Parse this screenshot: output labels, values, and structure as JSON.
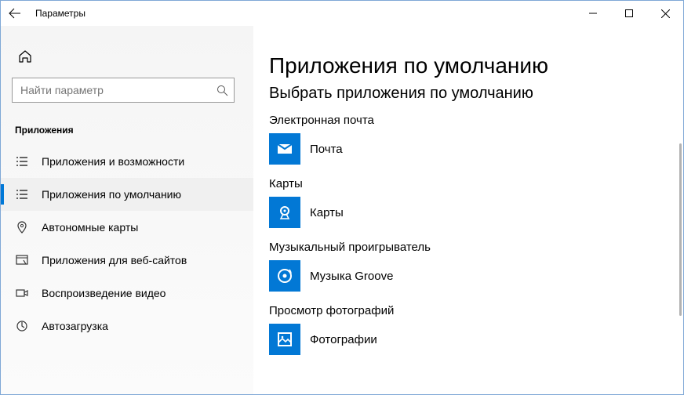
{
  "window": {
    "title": "Параметры"
  },
  "search": {
    "placeholder": "Найти параметр"
  },
  "category": {
    "label": "Приложения"
  },
  "nav": {
    "items": [
      {
        "label": "Приложения и возможности"
      },
      {
        "label": "Приложения по умолчанию"
      },
      {
        "label": "Автономные карты"
      },
      {
        "label": "Приложения для веб-сайтов"
      },
      {
        "label": "Воспроизведение видео"
      },
      {
        "label": "Автозагрузка"
      }
    ]
  },
  "main": {
    "title": "Приложения по умолчанию",
    "subtitle": "Выбрать приложения по умолчанию",
    "sections": [
      {
        "label": "Электронная почта",
        "app": "Почта"
      },
      {
        "label": "Карты",
        "app": "Карты"
      },
      {
        "label": "Музыкальный проигрыватель",
        "app": "Музыка Groove"
      },
      {
        "label": "Просмотр фотографий",
        "app": "Фотографии"
      }
    ]
  }
}
